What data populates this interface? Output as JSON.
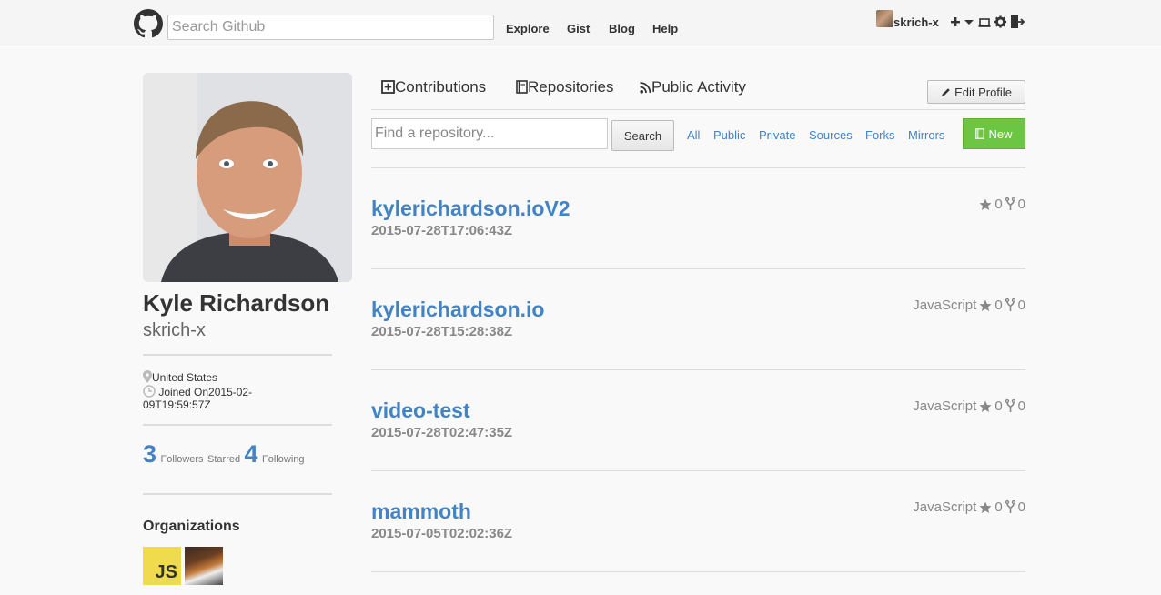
{
  "header": {
    "search_placeholder": "Search Github",
    "nav": [
      "Explore",
      "Gist",
      "Blog",
      "Help"
    ],
    "username": "skrich-x",
    "icons": [
      "github-logo-icon",
      "plus-icon",
      "caret-down-icon",
      "monitor-icon",
      "gear-icon",
      "sign-out-icon"
    ]
  },
  "profile": {
    "full_name": "Kyle Richardson",
    "login": "skrich-x",
    "location": "United States",
    "joined_line1": "Joined On2015-02-",
    "joined_line2": "09T19:59:57Z",
    "followers_count": "3",
    "followers_label": "Followers",
    "starred_label": "Starred",
    "following_count": "4",
    "following_label": "Following",
    "organizations_title": "Organizations",
    "org_js_label": "JS"
  },
  "tabs": {
    "contributions": "Contributions",
    "repositories": "Repositories",
    "public_activity": "Public Activity",
    "edit_profile": "Edit Profile"
  },
  "repo_toolbar": {
    "filter_placeholder": "Find a repository...",
    "search_label": "Search",
    "filters": [
      "All",
      "Public",
      "Private",
      "Sources",
      "Forks",
      "Mirrors"
    ],
    "new_label": "New"
  },
  "repos": [
    {
      "name": "kylerichardson.ioV2",
      "date": "2015-07-28T17:06:43Z",
      "language": "",
      "stars": "0",
      "forks": "0"
    },
    {
      "name": "kylerichardson.io",
      "date": "2015-07-28T15:28:38Z",
      "language": "JavaScript",
      "stars": "0",
      "forks": "0"
    },
    {
      "name": "video-test",
      "date": "2015-07-28T02:47:35Z",
      "language": "JavaScript",
      "stars": "0",
      "forks": "0"
    },
    {
      "name": "mammoth",
      "date": "2015-07-05T02:02:36Z",
      "language": "JavaScript",
      "stars": "0",
      "forks": "0"
    }
  ],
  "colors": {
    "link": "#4183c4",
    "new_button": "#6cc644"
  }
}
